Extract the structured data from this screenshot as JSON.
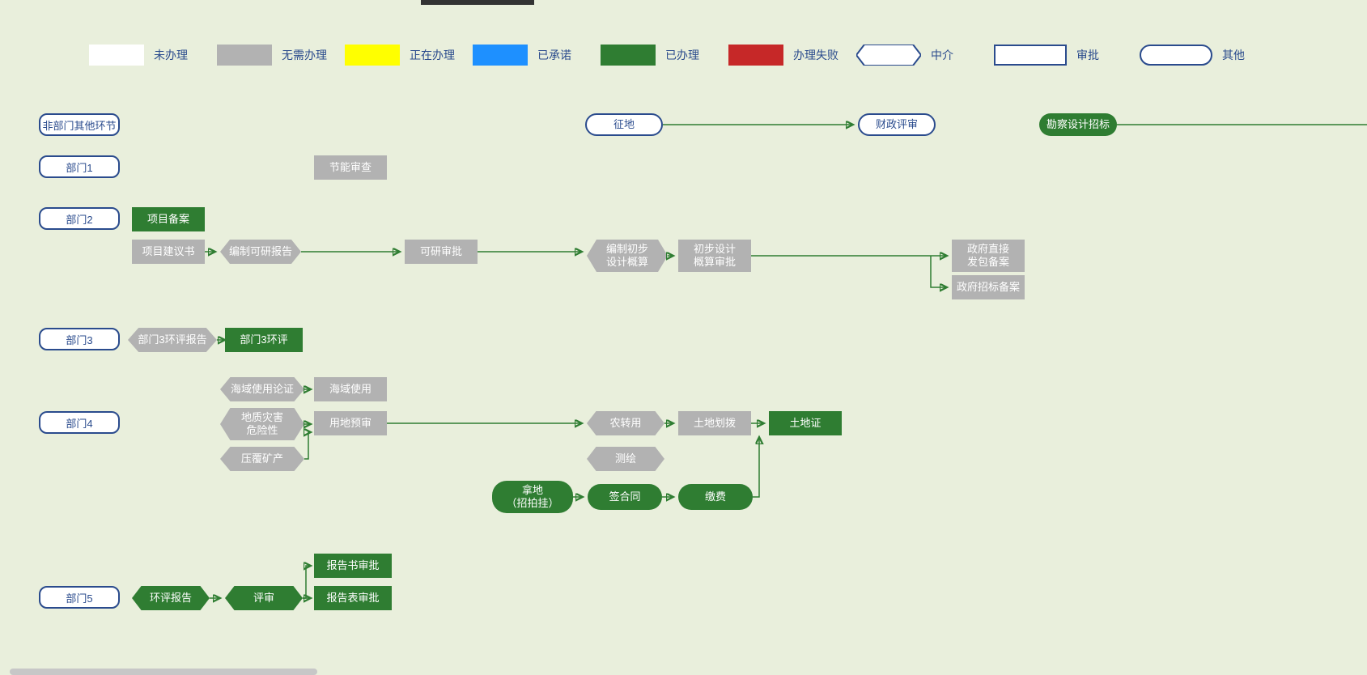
{
  "legend": {
    "unhandled": "未办理",
    "no_need": "无需办理",
    "in_progress": "正在办理",
    "promised": "已承诺",
    "done": "已办理",
    "failed": "办理失败",
    "intermediary": "中介",
    "approval": "审批",
    "other": "其他"
  },
  "rows": {
    "r0": "非部门其他环节",
    "r1": "部门1",
    "r2": "部门2",
    "r3": "部门3",
    "r4": "部门4",
    "r5": "部门5"
  },
  "nodes": {
    "zhengdi": "征地",
    "caizheng": "财政评审",
    "kancha": "勘察设计招标",
    "jieneng": "节能审查",
    "xiangmubeian": "项目备案",
    "jianyi": "项目建议书",
    "keyanbaogao": "编制可研报告",
    "keyanshenpi": "可研审批",
    "bianzhichubu": "编制初步\n设计概算",
    "chubusheji": "初步设计\n概算审批",
    "zhengfuzhijie": "政府直接\n发包备案",
    "zhengfuzhaobiao": "政府招标备案",
    "bumen3baogao": "部门3环评报告",
    "bumen3huanping": "部门3环评",
    "haiyushiyong": "海域使用论证",
    "haiyushiyong2": "海域使用",
    "dizhizaihai": "地质灾害\n危险性",
    "yongdiyushen": "用地预审",
    "yafu": "压覆矿产",
    "nongzhuan": "农转用",
    "tudihuabo": "土地划拨",
    "tudizheng": "土地证",
    "cehui": "测绘",
    "nadi": "拿地\n（招拍挂）",
    "qianhetong": "签合同",
    "jiaofei": "缴费",
    "huanpingbaogao": "环评报告",
    "pingshen": "评审",
    "baogaoshu": "报告书审批",
    "baogaobiao": "报告表审批"
  }
}
